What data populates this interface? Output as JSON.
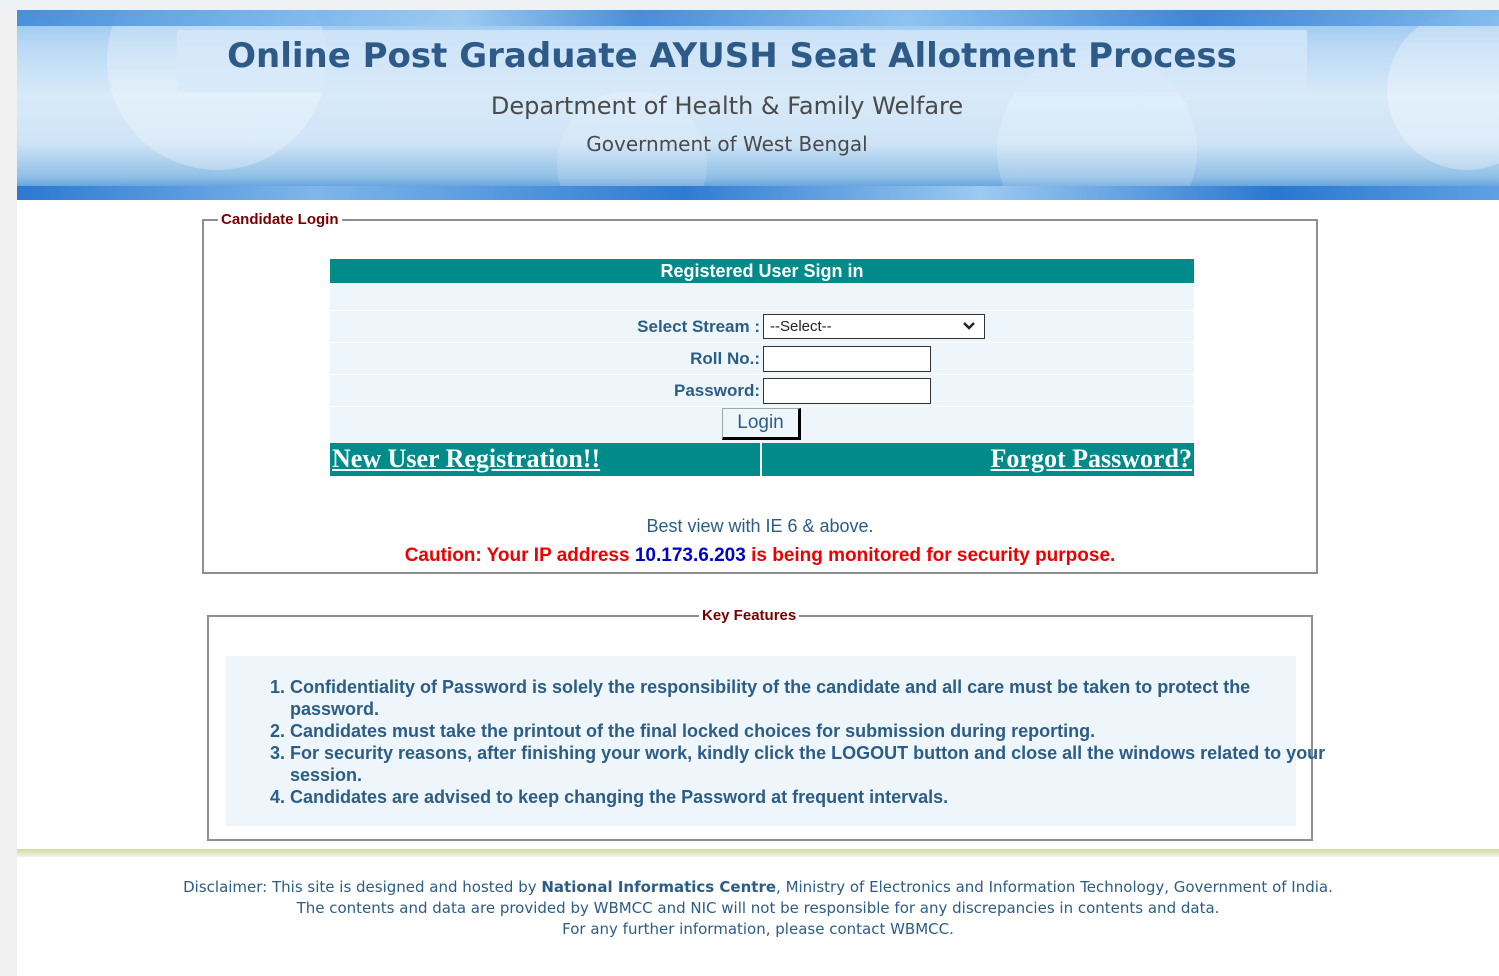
{
  "header": {
    "title": "Online Post Graduate AYUSH Seat Allotment Process",
    "department": "Department of Health & Family Welfare",
    "government": "Government of West Bengal"
  },
  "login": {
    "legend": "Candidate Login",
    "table_title": "Registered User Sign in",
    "stream_label": "Select Stream :",
    "stream_value": "--Select--",
    "roll_label": "Roll No.:",
    "roll_value": "",
    "password_label": "Password:",
    "password_value": "",
    "login_button": "Login",
    "new_user_link": "New User Registration!!",
    "forgot_link": "Forgot Password?",
    "best_view": "Best view with IE 6 & above.",
    "caution_prefix": "Caution: Your IP address ",
    "ip_address": "10.173.6.203",
    "caution_suffix": " is being monitored for security purpose."
  },
  "features": {
    "legend": "Key Features",
    "items": [
      "Confidentiality of Password is solely the responsibility of the candidate and all care must be taken to protect the password.",
      "Candidates must take the printout of the final locked choices for submission during reporting.",
      "For security reasons, after finishing your work, kindly click the LOGOUT button and close all the windows related to your session.",
      "Candidates are advised to keep changing the Password at frequent intervals."
    ]
  },
  "footer": {
    "line1_prefix": "Disclaimer: This site is designed and hosted by ",
    "line1_org": "National Informatics Centre",
    "line1_suffix": ", Ministry of Electronics and Information Technology, Government of India.",
    "line2": "The contents and data are provided by WBMCC and NIC will not be responsible for any discrepancies in contents and data.",
    "line3": "For any further information, please contact WBMCC."
  },
  "colors": {
    "teal_header": "#008b8b",
    "text_blue": "#2c5d87",
    "legend_red": "#7a0000",
    "caution_red": "#ee0000",
    "ip_blue": "#0000cc"
  },
  "icons": {
    "select_arrow": "chevron-down-icon"
  }
}
